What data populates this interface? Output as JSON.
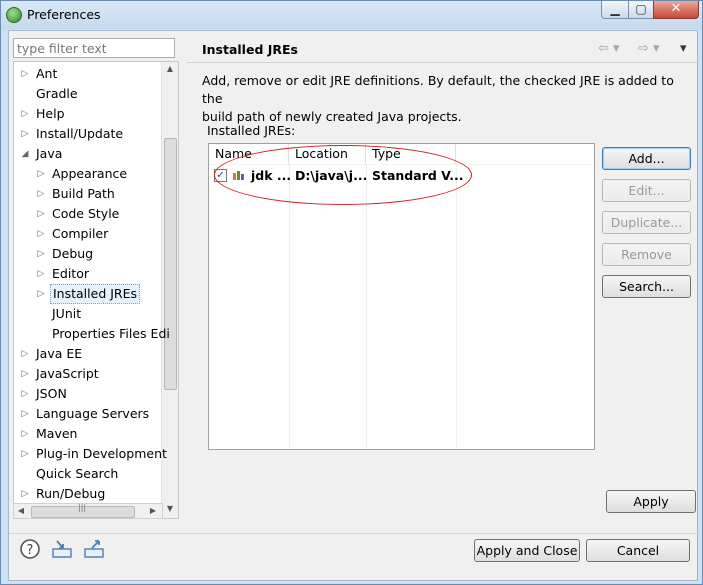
{
  "window": {
    "title": "Preferences"
  },
  "filter": {
    "placeholder": "type filter text",
    "value": ""
  },
  "tree": {
    "items": [
      {
        "label": "Ant",
        "indent": 0,
        "arrow": "▷"
      },
      {
        "label": "Gradle",
        "indent": 0,
        "arrow": ""
      },
      {
        "label": "Help",
        "indent": 0,
        "arrow": "▷"
      },
      {
        "label": "Install/Update",
        "indent": 0,
        "arrow": "▷"
      },
      {
        "label": "Java",
        "indent": 0,
        "arrow": "◢"
      },
      {
        "label": "Appearance",
        "indent": 1,
        "arrow": "▷"
      },
      {
        "label": "Build Path",
        "indent": 1,
        "arrow": "▷"
      },
      {
        "label": "Code Style",
        "indent": 1,
        "arrow": "▷"
      },
      {
        "label": "Compiler",
        "indent": 1,
        "arrow": "▷"
      },
      {
        "label": "Debug",
        "indent": 1,
        "arrow": "▷"
      },
      {
        "label": "Editor",
        "indent": 1,
        "arrow": "▷"
      },
      {
        "label": "Installed JREs",
        "indent": 1,
        "arrow": "▷",
        "selected": true
      },
      {
        "label": "JUnit",
        "indent": 1,
        "arrow": ""
      },
      {
        "label": "Properties Files Edi",
        "indent": 1,
        "arrow": ""
      },
      {
        "label": "Java EE",
        "indent": 0,
        "arrow": "▷"
      },
      {
        "label": "JavaScript",
        "indent": 0,
        "arrow": "▷"
      },
      {
        "label": "JSON",
        "indent": 0,
        "arrow": "▷"
      },
      {
        "label": "Language Servers",
        "indent": 0,
        "arrow": "▷"
      },
      {
        "label": "Maven",
        "indent": 0,
        "arrow": "▷"
      },
      {
        "label": "Plug-in Development",
        "indent": 0,
        "arrow": "▷"
      },
      {
        "label": "Quick Search",
        "indent": 0,
        "arrow": ""
      },
      {
        "label": "Run/Debug",
        "indent": 0,
        "arrow": "▷"
      }
    ]
  },
  "page": {
    "title": "Installed JREs",
    "description_line1": "Add, remove or edit JRE definitions. By default, the checked JRE is added to the",
    "description_line2": "build path of newly created Java projects.",
    "jres_label": "Installed JREs:"
  },
  "table": {
    "headers": [
      "Name",
      "Location",
      "Type"
    ],
    "rows": [
      {
        "checked": true,
        "name": "jdk ...",
        "location": "D:\\java\\j...",
        "type": "Standard V..."
      }
    ]
  },
  "buttons": {
    "add": "Add...",
    "edit": "Edit...",
    "duplicate": "Duplicate...",
    "remove": "Remove",
    "search": "Search...",
    "apply": "Apply",
    "apply_close": "Apply and Close",
    "cancel": "Cancel"
  },
  "icons": {
    "help": "help-icon",
    "import": "import-icon",
    "export": "export-icon",
    "back": "back-arrow-icon",
    "forward": "forward-arrow-icon",
    "menu": "view-menu-icon"
  },
  "colors": {
    "highlight_oval": "#d02020",
    "selected_item": "#e5f1fb"
  }
}
